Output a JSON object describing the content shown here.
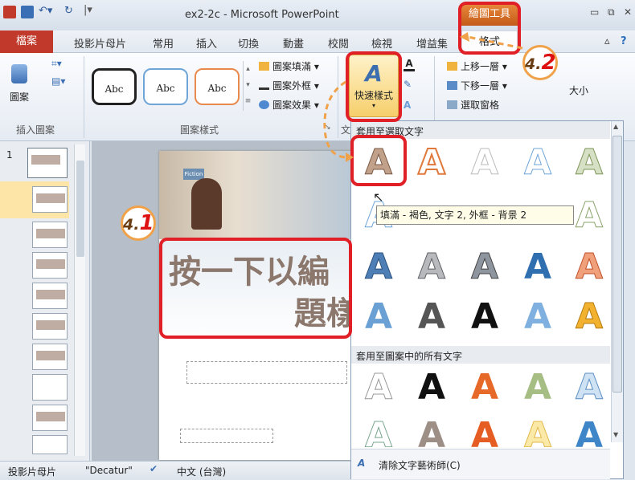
{
  "window": {
    "title": "ex2-2c - Microsoft PowerPoint",
    "contextual_header": "繪圖工具"
  },
  "tabs": {
    "file": "檔案",
    "items": [
      "投影片母片",
      "常用",
      "插入",
      "切換",
      "動畫",
      "校閱",
      "檢視",
      "增益集"
    ],
    "format": "格式"
  },
  "ribbon": {
    "insert_shape_label": "圖案",
    "group_insert_shapes": "插入圖案",
    "style_boxes": [
      "Abc",
      "Abc",
      "Abc"
    ],
    "shape_fill": "圖案填滿",
    "shape_outline": "圖案外框",
    "shape_effects": "圖案效果",
    "group_shape_styles": "圖案樣式",
    "quick_styles": "快速樣式",
    "group_wordart_prefix": "文",
    "bring_forward": "上移一層",
    "send_backward": "下移一層",
    "selection_pane": "選取窗格",
    "size": "大小"
  },
  "gallery": {
    "header_selected": "套用至選取文字",
    "header_all": "套用至圖案中的所有文字",
    "glyph": "A",
    "clear": "清除文字藝術師(C)",
    "tooltip": "填滿 - 褐色, 文字 2, 外框 - 背景 2",
    "colors": {
      "accent_red": "#e01f26",
      "badge_orange": "#f0a24a"
    }
  },
  "slide": {
    "title_text_1": "按一下以編",
    "title_text_2": "題樣",
    "thumb_number": "1",
    "photo_caption": "Fiction"
  },
  "steps": {
    "step_a": "4.",
    "step_a_num": "1",
    "step_b": "4.",
    "step_b_num": "2"
  },
  "status": {
    "view": "投影片母片",
    "theme": "\"Decatur\"",
    "language": "中文 (台灣)"
  }
}
